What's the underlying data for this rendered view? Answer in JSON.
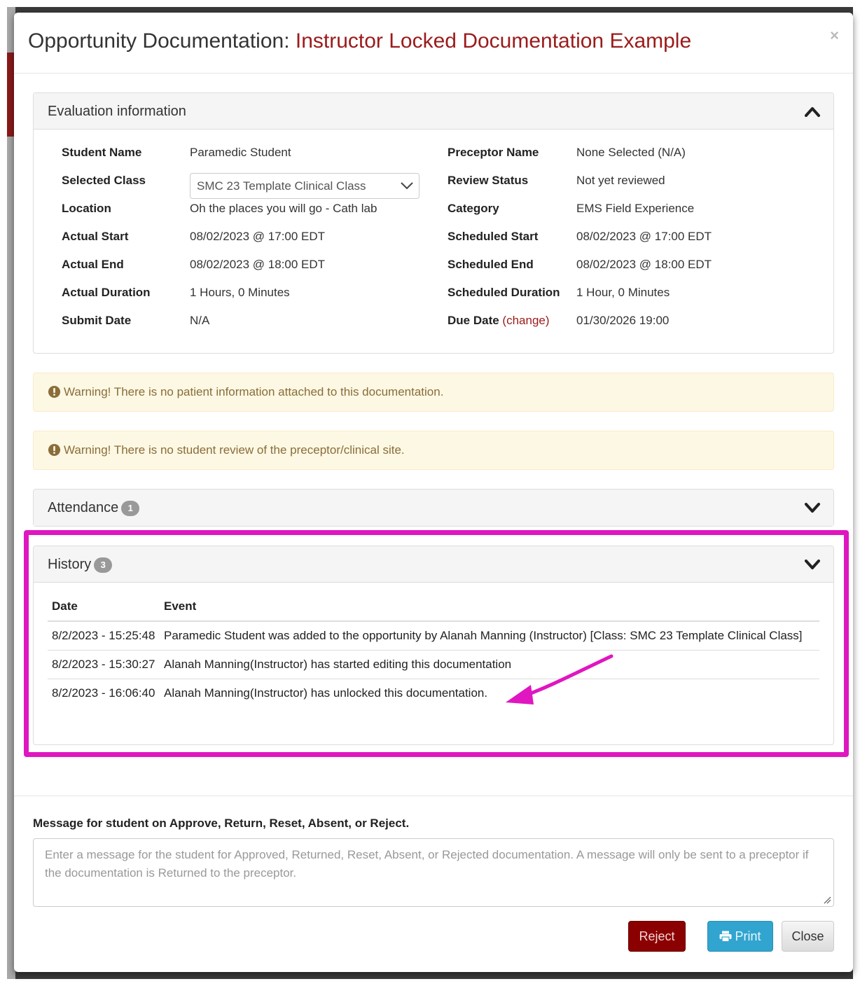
{
  "modal": {
    "title_prefix": "Opportunity Documentation: ",
    "title_name": "Instructor Locked Documentation Example",
    "close_glyph": "×"
  },
  "evaluation": {
    "heading": "Evaluation information",
    "left": [
      {
        "label": "Student Name",
        "value": "Paramedic Student"
      },
      {
        "label": "Selected Class",
        "value": "SMC 23 Template Clinical Class"
      },
      {
        "label": "Location",
        "value": "Oh the places you will go - Cath lab"
      },
      {
        "label": "Actual Start",
        "value": "08/02/2023 @ 17:00 EDT"
      },
      {
        "label": "Actual End",
        "value": "08/02/2023 @ 18:00 EDT"
      },
      {
        "label": "Actual Duration",
        "value": "1 Hours, 0 Minutes"
      },
      {
        "label": "Submit Date",
        "value": "N/A"
      }
    ],
    "right": [
      {
        "label": "Preceptor Name",
        "value": "None Selected (N/A)"
      },
      {
        "label": "Review Status",
        "value": "Not yet reviewed"
      },
      {
        "label": "Category",
        "value": "EMS Field Experience"
      },
      {
        "label": "Scheduled Start",
        "value": "08/02/2023 @ 17:00 EDT"
      },
      {
        "label": "Scheduled End",
        "value": "08/02/2023 @ 18:00 EDT"
      },
      {
        "label": "Scheduled Duration",
        "value": "1 Hour, 0 Minutes"
      },
      {
        "label": "Due Date",
        "value": "01/30/2026 19:00",
        "link": "(change)"
      }
    ]
  },
  "alerts": [
    "Warning! There is no patient information attached to this documentation.",
    "Warning! There is no student review of the preceptor/clinical site."
  ],
  "attendance": {
    "heading": "Attendance",
    "count": "1"
  },
  "history": {
    "heading": "History",
    "count": "3",
    "columns": [
      "Date",
      "Event"
    ],
    "rows": [
      {
        "date": "8/2/2023 - 15:25:48",
        "event": "Paramedic Student was added to the opportunity by Alanah Manning (Instructor) [Class: SMC 23 Template Clinical Class]"
      },
      {
        "date": "8/2/2023 - 15:30:27",
        "event": "Alanah Manning(Instructor) has started editing this documentation"
      },
      {
        "date": "8/2/2023 - 16:06:40",
        "event": "Alanah Manning(Instructor) has unlocked this documentation."
      }
    ]
  },
  "message": {
    "label": "Message for student on Approve, Return, Reset, Absent, or Reject.",
    "placeholder": "Enter a message for the student for Approved, Returned, Reset, Absent, or Rejected documentation. A message will only be sent to a preceptor if the documentation is Returned to the preceptor."
  },
  "buttons": {
    "reject": "Reject",
    "print": "Print",
    "close": "Close"
  },
  "colors": {
    "accent_red": "#9b1b1b",
    "warning_bg": "#fcf8e3",
    "warning_text": "#8a6d3b",
    "highlight": "#e016c0",
    "print_blue": "#31a5cf"
  }
}
